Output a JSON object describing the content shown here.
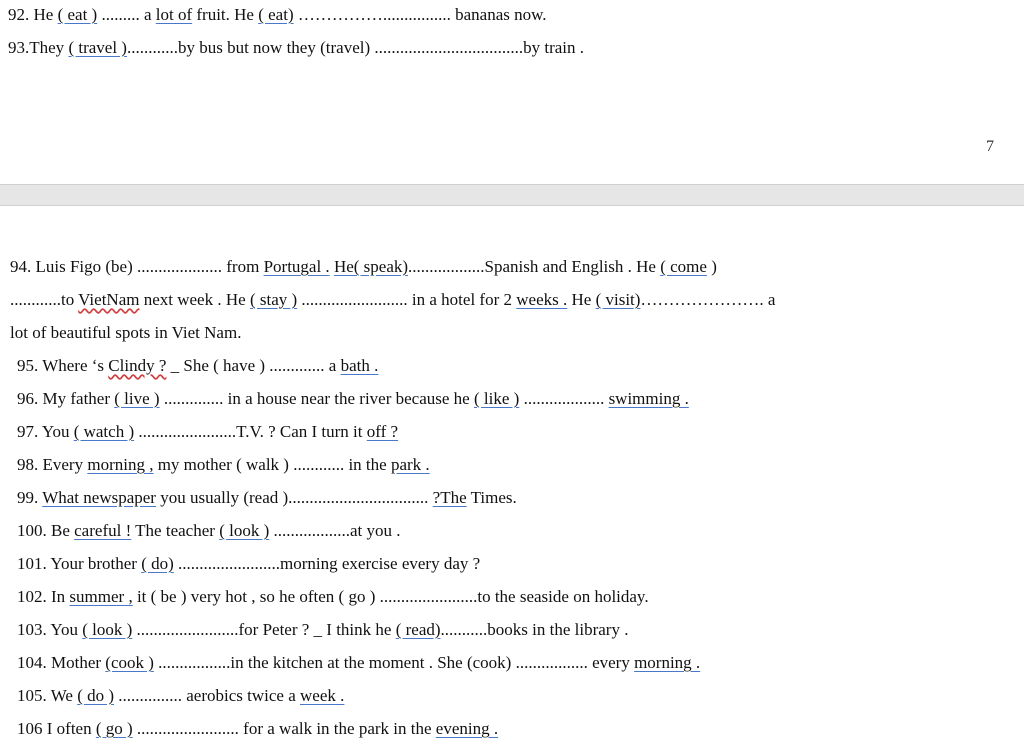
{
  "page_number": "7",
  "q92": {
    "p1": "92. He ",
    "p2": "( eat )",
    "p3": " ......... a ",
    "p4": "lot  of",
    "p5": " fruit. He ",
    "p6": "( eat)",
    "p7": " ……………................ bananas now."
  },
  "q93": {
    "p1": "93.They ",
    "p2": "( travel )",
    "p3": "............by bus but now they (travel) ...................................by train ."
  },
  "q94": {
    "a1": "94.  Luis  Figo  (be)  ....................  from  ",
    "a2": "Portugal .",
    "a3": "  ",
    "a4": "He( speak)",
    "a5": "..................Spanish  and  English  .  He  ",
    "a6": "( come",
    "a7": " )",
    "b1": "............to ",
    "b2": "VietNam",
    "b3": " next week . He ",
    "b4": "( stay )",
    "b5": " ......................... in a hotel for 2 ",
    "b6": "weeks .",
    "b7": " He ",
    "b8": "( visit)",
    "b9": "…………………. a",
    "c1": "lot of beautiful spots in Viet Nam."
  },
  "q95": {
    "p1": "95. Where ‘s ",
    "p2": "Clindy ?",
    "p3": " _ She ( have ) ............. a ",
    "p4": "bath ."
  },
  "q96": {
    "p1": "96. My father ",
    "p2": "( live )",
    "p3": " .............. in a house near the river because he ",
    "p4": "( like )",
    "p5": " ...................  ",
    "p6": "swimming ."
  },
  "q97": {
    "p1": "97. You ",
    "p2": "( watch )",
    "p3": " .......................T.V. ? Can I turn it ",
    "p4": "off ?"
  },
  "q98": {
    "p1": "98. Every ",
    "p2": "morning ,",
    "p3": " my mother ( walk ) ............ in the ",
    "p4": "park ."
  },
  "q99": {
    "p1": "99. ",
    "p2": "What  newspaper",
    "p3": "  you usually  (read ).................................  ",
    "p4": "?The",
    "p5": " Times."
  },
  "q100": {
    "p1": "100. Be ",
    "p2": "careful !",
    "p3": " The teacher ",
    "p4": "( look )",
    "p5": " ..................at you ."
  },
  "q101": {
    "p1": "101. Your brother ",
    "p2": "( do)",
    "p3": " ........................morning exercise every day ?"
  },
  "q102": {
    "p1": "102. In ",
    "p2": "summer ,",
    "p3": " it ( be ) very hot , so he often ( go ) .......................to the seaside on holiday."
  },
  "q103": {
    "p1": "103. You ",
    "p2": "( look )",
    "p3": " ........................for Peter ? _ I think he ",
    "p4": "( read)",
    "p5": "...........books in the library ."
  },
  "q104": {
    "p1": "104. Mother ",
    "p2": "(cook )",
    "p3": " .................in the kitchen at the moment . She (cook) ................. every ",
    "p4": "morning ."
  },
  "q105": {
    "p1": "105. We ",
    "p2": "( do )",
    "p3": " ............... aerobics twice a ",
    "p4": "week ."
  },
  "q106": {
    "p1": "106 I often ",
    "p2": "( go )",
    "p3": " ........................ for a walk in the park in the ",
    "p4": "evening ."
  }
}
